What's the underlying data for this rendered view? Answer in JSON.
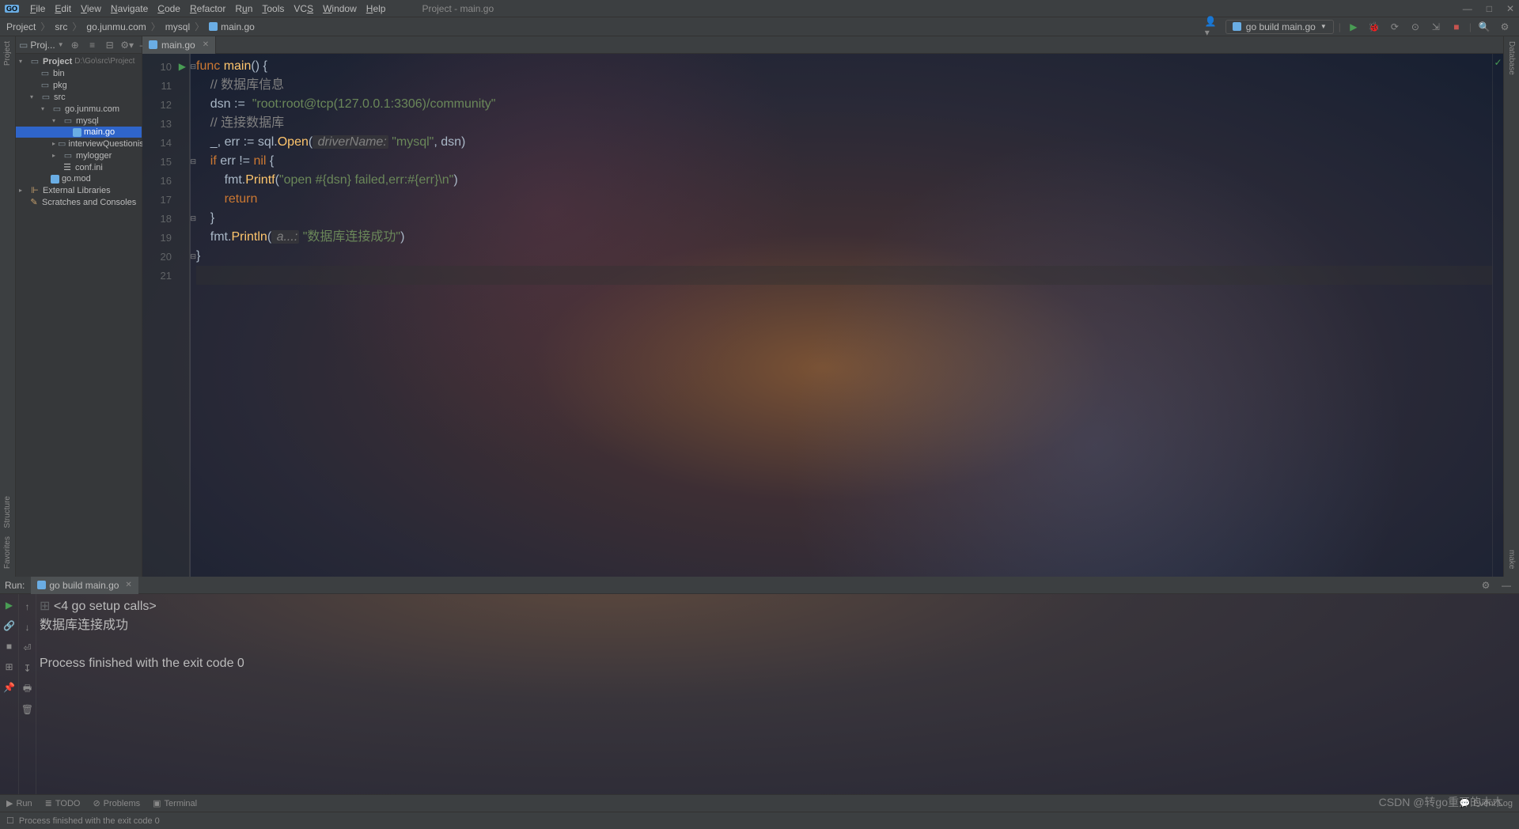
{
  "window": {
    "title": "Project - main.go",
    "badge": "GO"
  },
  "menu": {
    "file": "File",
    "edit": "Edit",
    "view": "View",
    "navigate": "Navigate",
    "code": "Code",
    "refactor": "Refactor",
    "run": "Run",
    "tools": "Tools",
    "vcs": "VCS",
    "window": "Window",
    "help": "Help"
  },
  "breadcrumbs": [
    "Project",
    "src",
    "go.junmu.com",
    "mysql",
    "main.go"
  ],
  "runConfig": {
    "label": "go build main.go"
  },
  "sidebar": {
    "title": "Proj...",
    "project": {
      "name": "Project",
      "path": "D:\\Go\\src\\Project"
    },
    "tree": {
      "bin": "bin",
      "pkg": "pkg",
      "src": "src",
      "gojunmu": "go.junmu.com",
      "mysql": "mysql",
      "maingo": "main.go",
      "interview": "interviewQuestionis",
      "mylogger": "mylogger",
      "confini": "conf.ini",
      "gomod": "go.mod",
      "external": "External Libraries",
      "scratches": "Scratches and Consoles"
    }
  },
  "editor": {
    "tab": "main.go",
    "lines": {
      "l10": {
        "num": "10",
        "func": "func ",
        "main": "main",
        "parens": "() {"
      },
      "l11": {
        "num": "11",
        "cmt": "// 数据库信息"
      },
      "l12": {
        "num": "12",
        "a": "dsn ",
        "op": ":= ",
        "str": "\"root:root@tcp(127.0.0.1:3306)/community\""
      },
      "l13": {
        "num": "13",
        "cmt": "// 连接数据库"
      },
      "l14": {
        "num": "14",
        "a": "_, err ",
        "op": ":= ",
        "b": "sql.",
        "fn": "Open",
        "c": "(",
        "p1": " driverName:",
        "s1": " \"mysql\"",
        "d": ", dsn)"
      },
      "l15": {
        "num": "15",
        "if": "if ",
        "cond": "err != ",
        "nil": "nil",
        "brace": " {"
      },
      "l16": {
        "num": "16",
        "a": "fmt.",
        "fn": "Printf",
        "b": "(",
        "str": "\"open #{dsn} failed,err:#{err}\\n\"",
        "c": ")"
      },
      "l17": {
        "num": "17",
        "ret": "return"
      },
      "l18": {
        "num": "18",
        "brace": "}"
      },
      "l19": {
        "num": "19",
        "a": "fmt.",
        "fn": "Println",
        "b": "(",
        "p1": " a...:",
        "str": " \"数据库连接成功\"",
        "c": ")"
      },
      "l20": {
        "num": "20",
        "brace": "}"
      },
      "l21": {
        "num": "21"
      }
    }
  },
  "run": {
    "label": "Run:",
    "tab": "go build main.go",
    "console": {
      "l1": "<4 go setup calls>",
      "l2": "数据库连接成功",
      "l3": "",
      "l4": "Process finished with the exit code 0"
    }
  },
  "bottomTools": {
    "run": "Run",
    "todo": "TODO",
    "problems": "Problems",
    "terminal": "Terminal",
    "eventlog": "Event Log"
  },
  "status": {
    "msg": "Process finished with the exit code 0"
  },
  "stripes": {
    "project": "Project",
    "structure": "Structure",
    "favorites": "Favorites",
    "database": "Database",
    "make": "make"
  },
  "watermark": "CSDN @转go重开的木木"
}
